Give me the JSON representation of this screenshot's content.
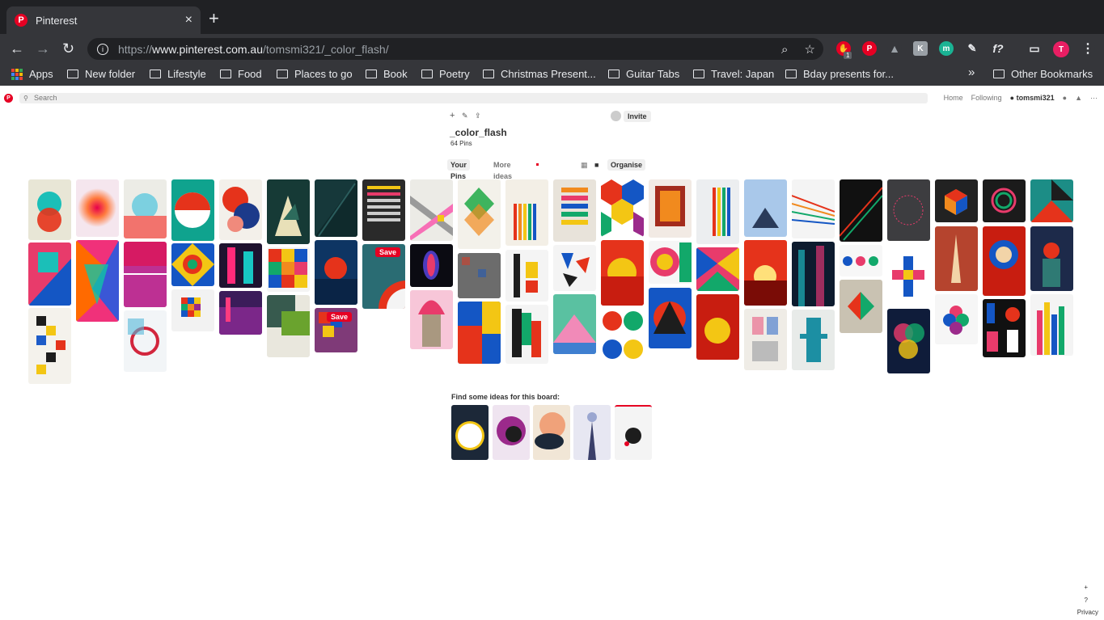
{
  "browser": {
    "tab_title": "Pinterest",
    "tab_close": "×",
    "new_tab": "+",
    "url_prefix": "https://",
    "url_host": "www.pinterest.com.au",
    "url_path": "/tomsmi321/_color_flash/",
    "extension_badge": "1",
    "profile_initial": "T"
  },
  "bookmarks": {
    "apps": "Apps",
    "items": [
      "New folder",
      "Lifestyle",
      "Food",
      "Places to go",
      "Book",
      "Poetry",
      "Christmas Present...",
      "Guitar Tabs",
      "Travel: Japan",
      "Bday presents for..."
    ],
    "overflow": "»",
    "other": "Other Bookmarks"
  },
  "pinterest": {
    "search_placeholder": "Search",
    "nav_home": "Home",
    "nav_following": "Following",
    "nav_user": "tomsmi321",
    "board_title": "_color_flash",
    "pin_count": "64 Pins",
    "invite_label": "Invite",
    "tab_your_pins": "Your Pins",
    "tab_more_ideas": "More ideas",
    "organise_label": "Organise",
    "save_label": "Save",
    "find_ideas": "Find some ideas for this board:",
    "footer_plus": "+",
    "footer_help": "?",
    "footer_privacy": "Privacy"
  },
  "colors": {
    "pinterest_red": "#e60023",
    "chrome_dark": "#202124",
    "chrome_toolbar": "#35363a"
  }
}
